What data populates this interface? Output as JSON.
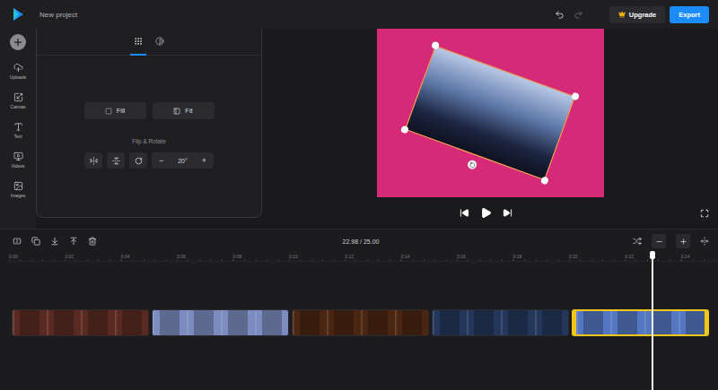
{
  "window": {
    "title": "New project"
  },
  "header_buttons": [
    {
      "label": "Upgrade",
      "kind": "upgrade"
    },
    {
      "label": "Export",
      "kind": "primary"
    }
  ],
  "sidebar": {
    "items": [
      {
        "label": "Uploads",
        "kind": "uploads"
      },
      {
        "label": "Canvas",
        "kind": "canvas"
      },
      {
        "label": "Text",
        "kind": "text"
      },
      {
        "label": "Videos",
        "kind": "videos"
      },
      {
        "label": "Images",
        "kind": "images"
      }
    ]
  },
  "panel": {
    "tabs": [
      {
        "kind": "layout",
        "selected": true
      },
      {
        "kind": "adjust",
        "selected": false
      }
    ],
    "fit_buttons": [
      {
        "label": "Fill",
        "kind": "fill"
      },
      {
        "label": "Fit",
        "kind": "fit"
      }
    ],
    "flip_rotate": {
      "label": "Flip & Rotate",
      "decrement": "−",
      "value": "20°",
      "increment": "+"
    }
  },
  "preview": {
    "rotation": 20,
    "selected": true
  },
  "timeline": {
    "time": "22.98 / 25.00",
    "playhead_seconds": 22.98,
    "ruler": [
      "0:00",
      "0:02",
      "0:04",
      "0:06",
      "0:08",
      "0:10",
      "0:12",
      "0:14",
      "0:16",
      "0:18",
      "0:20",
      "0:22",
      "0:24"
    ],
    "clips": [
      {
        "seconds": 5,
        "selected": false,
        "color": "#5a2a22"
      },
      {
        "seconds": 5,
        "selected": false,
        "color": "#7d8cc0"
      },
      {
        "seconds": 5,
        "selected": false,
        "color": "#4a2612"
      },
      {
        "seconds": 5,
        "selected": false,
        "color": "#24365a"
      },
      {
        "seconds": 5,
        "selected": true,
        "color": "#5576c0"
      }
    ]
  }
}
